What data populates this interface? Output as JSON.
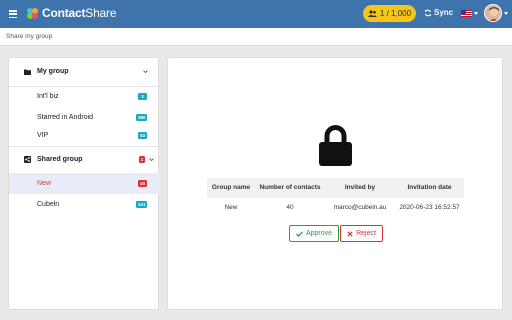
{
  "header": {
    "brand_contact": "Contact",
    "brand_share": "Share",
    "quota": "1 / 1,000",
    "sync_label": "Sync"
  },
  "breadcrumb": "Share my group",
  "sidebar": {
    "my_group": {
      "title": "My group",
      "items": [
        {
          "label": "Int'l biz",
          "count": "3",
          "color": "#1aa7c1"
        },
        {
          "label": "Starred in Android",
          "count": "380",
          "color": "#1aa7c1"
        },
        {
          "label": "VIP",
          "count": "53",
          "color": "#1aa7c1"
        }
      ]
    },
    "shared_group": {
      "title": "Shared group",
      "badge": "1",
      "items": [
        {
          "label": "New",
          "count": "40",
          "color": "#d9303a",
          "active": true
        },
        {
          "label": "Cubeln",
          "count": "341",
          "color": "#1aa7c1"
        }
      ]
    }
  },
  "invite_table": {
    "headers": [
      "Group name",
      "Number of contacts",
      "Invited by",
      "Invitation date"
    ],
    "rows": [
      [
        "New",
        "40",
        "marco@cubein.au",
        "2020-06-23 16:52:57"
      ]
    ]
  },
  "actions": {
    "approve": "Approve",
    "reject": "Reject"
  },
  "colors": {
    "header_bg": "#3f73ac",
    "quota_bg": "#f5c518",
    "approve": "#2f9e44",
    "reject": "#d9303a",
    "badge_teal": "#1aa7c1"
  },
  "icons": [
    "menu-icon",
    "contactshare-logo",
    "users-icon",
    "sync-icon",
    "us-flag-icon",
    "avatar",
    "folder-icon",
    "share-icon",
    "chevron-down-icon",
    "lock-icon",
    "check-icon",
    "close-icon"
  ]
}
